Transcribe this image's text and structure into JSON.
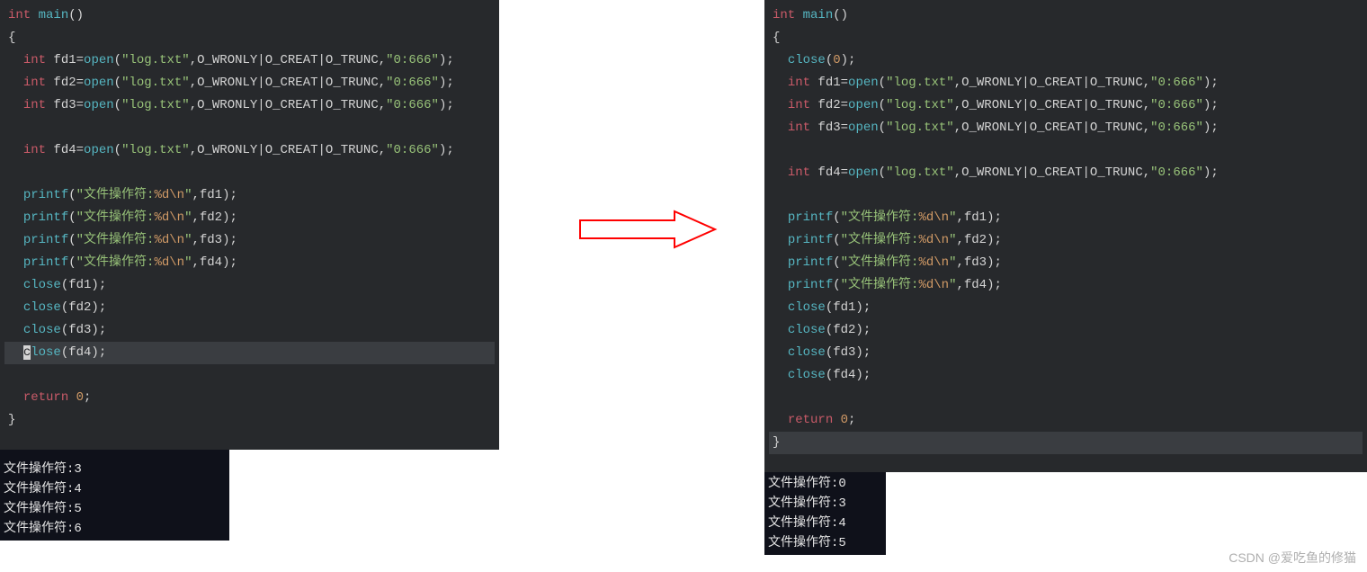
{
  "left": {
    "lines": [
      [
        {
          "t": "kw",
          "v": "int"
        },
        {
          "t": "op",
          "v": " "
        },
        {
          "t": "fn",
          "v": "main"
        },
        {
          "t": "op",
          "v": "()"
        }
      ],
      [
        {
          "t": "op",
          "v": "{"
        }
      ],
      [
        {
          "t": "op",
          "v": "  "
        },
        {
          "t": "kw",
          "v": "int"
        },
        {
          "t": "op",
          "v": " fd1="
        },
        {
          "t": "fn",
          "v": "open"
        },
        {
          "t": "op",
          "v": "("
        },
        {
          "t": "str",
          "v": "\"log.txt\""
        },
        {
          "t": "op",
          "v": ",O_WRONLY|O_CREAT|O_TRUNC,"
        },
        {
          "t": "str",
          "v": "\"0:666\""
        },
        {
          "t": "op",
          "v": ");"
        }
      ],
      [
        {
          "t": "op",
          "v": "  "
        },
        {
          "t": "kw",
          "v": "int"
        },
        {
          "t": "op",
          "v": " fd2="
        },
        {
          "t": "fn",
          "v": "open"
        },
        {
          "t": "op",
          "v": "("
        },
        {
          "t": "str",
          "v": "\"log.txt\""
        },
        {
          "t": "op",
          "v": ",O_WRONLY|O_CREAT|O_TRUNC,"
        },
        {
          "t": "str",
          "v": "\"0:666\""
        },
        {
          "t": "op",
          "v": ");"
        }
      ],
      [
        {
          "t": "op",
          "v": "  "
        },
        {
          "t": "kw",
          "v": "int"
        },
        {
          "t": "op",
          "v": " fd3="
        },
        {
          "t": "fn",
          "v": "open"
        },
        {
          "t": "op",
          "v": "("
        },
        {
          "t": "str",
          "v": "\"log.txt\""
        },
        {
          "t": "op",
          "v": ",O_WRONLY|O_CREAT|O_TRUNC,"
        },
        {
          "t": "str",
          "v": "\"0:666\""
        },
        {
          "t": "op",
          "v": ");"
        }
      ],
      [
        {
          "t": "op",
          "v": " "
        }
      ],
      [
        {
          "t": "op",
          "v": "  "
        },
        {
          "t": "kw",
          "v": "int"
        },
        {
          "t": "op",
          "v": " fd4="
        },
        {
          "t": "fn",
          "v": "open"
        },
        {
          "t": "op",
          "v": "("
        },
        {
          "t": "str",
          "v": "\"log.txt\""
        },
        {
          "t": "op",
          "v": ",O_WRONLY|O_CREAT|O_TRUNC,"
        },
        {
          "t": "str",
          "v": "\"0:666\""
        },
        {
          "t": "op",
          "v": ");"
        }
      ],
      [
        {
          "t": "op",
          "v": " "
        }
      ],
      [
        {
          "t": "op",
          "v": "  "
        },
        {
          "t": "fn",
          "v": "printf"
        },
        {
          "t": "op",
          "v": "("
        },
        {
          "t": "str",
          "v": "\"文件操作符:"
        },
        {
          "t": "num",
          "v": "%d\\n"
        },
        {
          "t": "str",
          "v": "\""
        },
        {
          "t": "op",
          "v": ",fd1);"
        }
      ],
      [
        {
          "t": "op",
          "v": "  "
        },
        {
          "t": "fn",
          "v": "printf"
        },
        {
          "t": "op",
          "v": "("
        },
        {
          "t": "str",
          "v": "\"文件操作符:"
        },
        {
          "t": "num",
          "v": "%d\\n"
        },
        {
          "t": "str",
          "v": "\""
        },
        {
          "t": "op",
          "v": ",fd2);"
        }
      ],
      [
        {
          "t": "op",
          "v": "  "
        },
        {
          "t": "fn",
          "v": "printf"
        },
        {
          "t": "op",
          "v": "("
        },
        {
          "t": "str",
          "v": "\"文件操作符:"
        },
        {
          "t": "num",
          "v": "%d\\n"
        },
        {
          "t": "str",
          "v": "\""
        },
        {
          "t": "op",
          "v": ",fd3);"
        }
      ],
      [
        {
          "t": "op",
          "v": "  "
        },
        {
          "t": "fn",
          "v": "printf"
        },
        {
          "t": "op",
          "v": "("
        },
        {
          "t": "str",
          "v": "\"文件操作符:"
        },
        {
          "t": "num",
          "v": "%d\\n"
        },
        {
          "t": "str",
          "v": "\""
        },
        {
          "t": "op",
          "v": ",fd4);"
        }
      ],
      [
        {
          "t": "op",
          "v": "  "
        },
        {
          "t": "fn",
          "v": "close"
        },
        {
          "t": "op",
          "v": "(fd1);"
        }
      ],
      [
        {
          "t": "op",
          "v": "  "
        },
        {
          "t": "fn",
          "v": "close"
        },
        {
          "t": "op",
          "v": "(fd2);"
        }
      ],
      [
        {
          "t": "op",
          "v": "  "
        },
        {
          "t": "fn",
          "v": "close"
        },
        {
          "t": "op",
          "v": "(fd3);"
        }
      ],
      [
        {
          "t": "op",
          "v": "  "
        },
        {
          "t": "cursor",
          "v": "c"
        },
        {
          "t": "fn",
          "v": "lose"
        },
        {
          "t": "op",
          "v": "(fd4);"
        }
      ],
      [
        {
          "t": "op",
          "v": " "
        }
      ],
      [
        {
          "t": "op",
          "v": "  "
        },
        {
          "t": "kw",
          "v": "return"
        },
        {
          "t": "op",
          "v": " "
        },
        {
          "t": "num",
          "v": "0"
        },
        {
          "t": "op",
          "v": ";"
        }
      ],
      [
        {
          "t": "op",
          "v": "}"
        }
      ]
    ],
    "highlightLine": 15,
    "output": [
      "文件操作符:3",
      "文件操作符:4",
      "文件操作符:5",
      "文件操作符:6"
    ]
  },
  "right": {
    "lines": [
      [
        {
          "t": "kw",
          "v": "int"
        },
        {
          "t": "op",
          "v": " "
        },
        {
          "t": "fn",
          "v": "main"
        },
        {
          "t": "op",
          "v": "()"
        }
      ],
      [
        {
          "t": "op",
          "v": "{"
        }
      ],
      [
        {
          "t": "op",
          "v": "  "
        },
        {
          "t": "fn",
          "v": "close"
        },
        {
          "t": "op",
          "v": "("
        },
        {
          "t": "num",
          "v": "0"
        },
        {
          "t": "op",
          "v": ");"
        }
      ],
      [
        {
          "t": "op",
          "v": "  "
        },
        {
          "t": "kw",
          "v": "int"
        },
        {
          "t": "op",
          "v": " fd1="
        },
        {
          "t": "fn",
          "v": "open"
        },
        {
          "t": "op",
          "v": "("
        },
        {
          "t": "str",
          "v": "\"log.txt\""
        },
        {
          "t": "op",
          "v": ",O_WRONLY|O_CREAT|O_TRUNC,"
        },
        {
          "t": "str",
          "v": "\"0:666\""
        },
        {
          "t": "op",
          "v": ");"
        }
      ],
      [
        {
          "t": "op",
          "v": "  "
        },
        {
          "t": "kw",
          "v": "int"
        },
        {
          "t": "op",
          "v": " fd2="
        },
        {
          "t": "fn",
          "v": "open"
        },
        {
          "t": "op",
          "v": "("
        },
        {
          "t": "str",
          "v": "\"log.txt\""
        },
        {
          "t": "op",
          "v": ",O_WRONLY|O_CREAT|O_TRUNC,"
        },
        {
          "t": "str",
          "v": "\"0:666\""
        },
        {
          "t": "op",
          "v": ");"
        }
      ],
      [
        {
          "t": "op",
          "v": "  "
        },
        {
          "t": "kw",
          "v": "int"
        },
        {
          "t": "op",
          "v": " fd3="
        },
        {
          "t": "fn",
          "v": "open"
        },
        {
          "t": "op",
          "v": "("
        },
        {
          "t": "str",
          "v": "\"log.txt\""
        },
        {
          "t": "op",
          "v": ",O_WRONLY|O_CREAT|O_TRUNC,"
        },
        {
          "t": "str",
          "v": "\"0:666\""
        },
        {
          "t": "op",
          "v": ");"
        }
      ],
      [
        {
          "t": "op",
          "v": " "
        }
      ],
      [
        {
          "t": "op",
          "v": "  "
        },
        {
          "t": "kw",
          "v": "int"
        },
        {
          "t": "op",
          "v": " fd4="
        },
        {
          "t": "fn",
          "v": "open"
        },
        {
          "t": "op",
          "v": "("
        },
        {
          "t": "str",
          "v": "\"log.txt\""
        },
        {
          "t": "op",
          "v": ",O_WRONLY|O_CREAT|O_TRUNC,"
        },
        {
          "t": "str",
          "v": "\"0:666\""
        },
        {
          "t": "op",
          "v": ");"
        }
      ],
      [
        {
          "t": "op",
          "v": " "
        }
      ],
      [
        {
          "t": "op",
          "v": "  "
        },
        {
          "t": "fn",
          "v": "printf"
        },
        {
          "t": "op",
          "v": "("
        },
        {
          "t": "str",
          "v": "\"文件操作符:"
        },
        {
          "t": "num",
          "v": "%d\\n"
        },
        {
          "t": "str",
          "v": "\""
        },
        {
          "t": "op",
          "v": ",fd1);"
        }
      ],
      [
        {
          "t": "op",
          "v": "  "
        },
        {
          "t": "fn",
          "v": "printf"
        },
        {
          "t": "op",
          "v": "("
        },
        {
          "t": "str",
          "v": "\"文件操作符:"
        },
        {
          "t": "num",
          "v": "%d\\n"
        },
        {
          "t": "str",
          "v": "\""
        },
        {
          "t": "op",
          "v": ",fd2);"
        }
      ],
      [
        {
          "t": "op",
          "v": "  "
        },
        {
          "t": "fn",
          "v": "printf"
        },
        {
          "t": "op",
          "v": "("
        },
        {
          "t": "str",
          "v": "\"文件操作符:"
        },
        {
          "t": "num",
          "v": "%d\\n"
        },
        {
          "t": "str",
          "v": "\""
        },
        {
          "t": "op",
          "v": ",fd3);"
        }
      ],
      [
        {
          "t": "op",
          "v": "  "
        },
        {
          "t": "fn",
          "v": "printf"
        },
        {
          "t": "op",
          "v": "("
        },
        {
          "t": "str",
          "v": "\"文件操作符:"
        },
        {
          "t": "num",
          "v": "%d\\n"
        },
        {
          "t": "str",
          "v": "\""
        },
        {
          "t": "op",
          "v": ",fd4);"
        }
      ],
      [
        {
          "t": "op",
          "v": "  "
        },
        {
          "t": "fn",
          "v": "close"
        },
        {
          "t": "op",
          "v": "(fd1);"
        }
      ],
      [
        {
          "t": "op",
          "v": "  "
        },
        {
          "t": "fn",
          "v": "close"
        },
        {
          "t": "op",
          "v": "(fd2);"
        }
      ],
      [
        {
          "t": "op",
          "v": "  "
        },
        {
          "t": "fn",
          "v": "close"
        },
        {
          "t": "op",
          "v": "(fd3);"
        }
      ],
      [
        {
          "t": "op",
          "v": "  "
        },
        {
          "t": "fn",
          "v": "close"
        },
        {
          "t": "op",
          "v": "(fd4);"
        }
      ],
      [
        {
          "t": "op",
          "v": " "
        }
      ],
      [
        {
          "t": "op",
          "v": "  "
        },
        {
          "t": "kw",
          "v": "return"
        },
        {
          "t": "op",
          "v": " "
        },
        {
          "t": "num",
          "v": "0"
        },
        {
          "t": "op",
          "v": ";"
        }
      ],
      [
        {
          "t": "op",
          "v": "}"
        }
      ]
    ],
    "highlightLine": 19,
    "output": [
      "文件操作符:0",
      "文件操作符:3",
      "文件操作符:4",
      "文件操作符:5"
    ]
  },
  "watermark": "CSDN @爱吃鱼的修猫"
}
